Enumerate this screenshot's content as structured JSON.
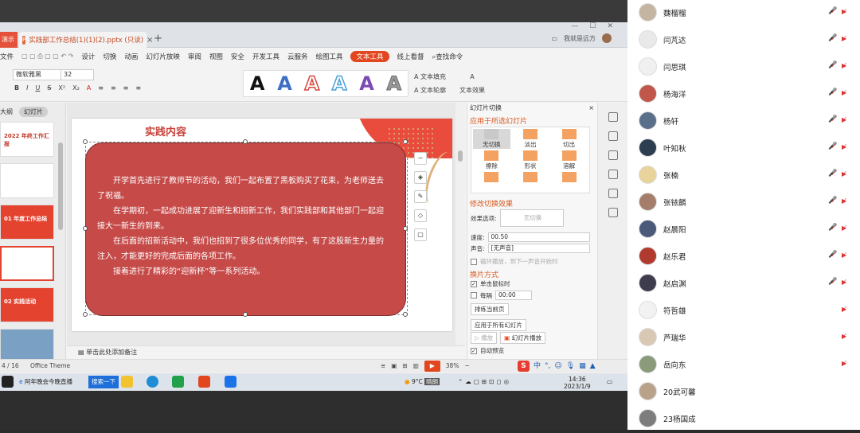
{
  "wps": {
    "left_tab": "演示",
    "doc_title": "实践部工作总结(1)(1)(2).pptx (只读)",
    "user_name": "我就是远方",
    "menu_items": [
      "文件",
      "设计",
      "切换",
      "动画",
      "幻灯片放映",
      "审阅",
      "视图",
      "安全",
      "开发工具",
      "云服务",
      "绘图工具"
    ],
    "active_menu": "文本工具",
    "menu_extra": [
      "线上看督",
      "查找命令"
    ],
    "font_name": "微软雅黑",
    "font_size": "32",
    "text_fill": "A 文本填充",
    "text_outline": "A 文本轮廓",
    "text_effect": "文本效果",
    "lp_tabs": [
      "大纲",
      "幻灯片"
    ],
    "thumb_titles": [
      "2022 年终工作汇报",
      "",
      "01 年度工作总结",
      "",
      "02 实践活动",
      ""
    ],
    "slide_title": "实践内容",
    "paragraphs": [
      "开学首先进行了教师节的活动，我们一起布置了黑板购买了花束，为老师送去了祝福。",
      "在学期初，一起成功进展了迎新生和招新工作，我们实践部和其他部门一起迎接大一新生的到来。",
      "在后面的招新活动中，我们也招到了很多位优秀的同学，有了这股新生力量的注入，才能更好的完成后面的各项工作。",
      "接着进行了精彩的“迎新杯”等一系列活动。"
    ],
    "notes": "单击此处添加备注",
    "status_page": "4 / 16",
    "status_theme": "Office Theme",
    "zoom": "38%",
    "right_panel": {
      "title": "幻灯片切换",
      "section_apply": "应用于所选幻灯片",
      "transitions": [
        "无切换",
        "淡出",
        "切出",
        "擦除",
        "形状",
        "溶解",
        "",
        "",
        ""
      ],
      "section_modify": "修改切换效果",
      "effect_label": "效果选项:",
      "effect_value": "无切换",
      "speed_label": "速度:",
      "speed_value": "00.50",
      "sound_label": "声音:",
      "sound_value": "[无声音]",
      "loop_label": "循环播放，到下一声音开始时",
      "section_switch": "换片方式",
      "click_label": "单击鼠标时",
      "interval_label": "每隔",
      "interval_value": "00:00",
      "rehearse_btn": "排练当前页",
      "apply_all_btn": "应用于所有幻灯片",
      "play_btn": "播放",
      "slideshow_btn": "幻灯片播放",
      "auto_preview": "自动预览"
    }
  },
  "taskbar": {
    "item1": "阿年晚会今晚直播",
    "item2": "搜索一下",
    "weather": "9°C",
    "weather_tag": "晴朗",
    "time": "14:36",
    "date": "2023/1/9"
  },
  "attendees": [
    "魏榴榴",
    "闫芃达",
    "闫思琪",
    "杨海洋",
    "杨轩",
    "叶知秋",
    "张楠",
    "张铱麟",
    "赵晨阳",
    "赵乐君",
    "赵启渊",
    "符哲雄",
    "芦瑞华",
    "岳向东",
    "20武可馨",
    "23杨国成"
  ],
  "colors": {
    "accent": "#e2461f",
    "textbox_fill": "#c54a48",
    "title_red": "#c8423a"
  }
}
